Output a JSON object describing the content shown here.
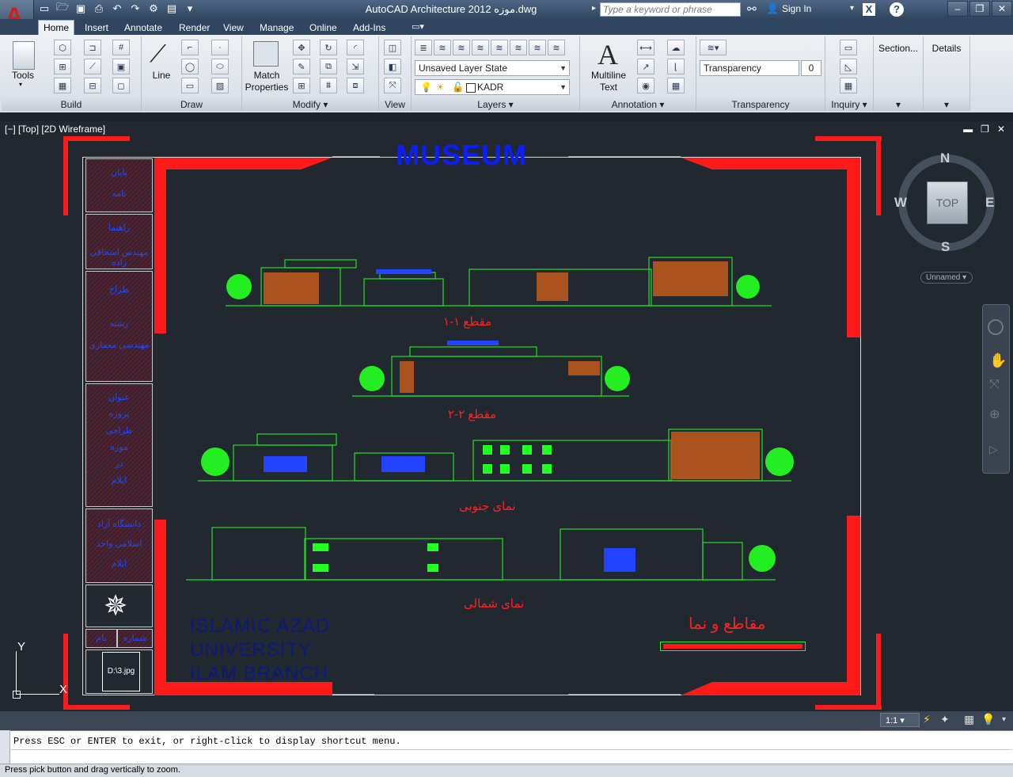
{
  "app": {
    "title": "AutoCAD Architecture 2012   موزه.dwg",
    "search_placeholder": "Type a keyword or phrase",
    "sign_in": "Sign In",
    "app_letter": "A",
    "app_badge": "A"
  },
  "tabs": [
    "Home",
    "Insert",
    "Annotate",
    "Render",
    "View",
    "Manage",
    "Online",
    "Add-Ins"
  ],
  "ribbon": {
    "panels": {
      "build": "Build",
      "draw": "Draw",
      "modify": "Modify",
      "view": "View",
      "layers": "Layers",
      "annotation": "Annotation",
      "transparency": "Transparency",
      "inquiry": "Inquiry"
    },
    "tools_label": "Tools",
    "line_label": "Line",
    "match_properties_label": "Match Properties",
    "match_label_1": "Match",
    "match_label_2": "Properties",
    "multiline_label_1": "Multiline",
    "multiline_label_2": "Text",
    "layer_state": "Unsaved Layer State",
    "current_layer": "KADR",
    "transparency_label": "Transparency",
    "transparency_value": "0",
    "section_label": "Section...",
    "details_label": "Details"
  },
  "viewport": {
    "label": "[−] [Top] [2D Wireframe]",
    "wcs": "Unnamed"
  },
  "drawing": {
    "title": "MUSEUM",
    "sections": [
      "مقطع ۱-۱",
      "مقطع ۲-۲",
      "نمای جنوبی",
      "نمای شمالی"
    ],
    "sheet_title": "مقاطع و نما",
    "university_lines": [
      "ISLAMIC AZAD",
      "UNIVERSITY",
      "ILAM BRANCH"
    ],
    "side_cells": [
      [
        "پایان",
        "نامه"
      ],
      [
        "راهنما",
        "مهندس اسحاقی زاده"
      ],
      [
        "طراح",
        "",
        "رشته",
        "مهندسی معماری"
      ],
      [
        "عنوان",
        "پروژه",
        "طراحی",
        "موزه",
        "در",
        "ایلام"
      ],
      [
        "دانشگاه   آزاد",
        "اسلامی  واحد",
        "ایلام"
      ]
    ],
    "small_cells": [
      "نام",
      "شماره"
    ],
    "logo_caption": "D:\\3.jpg"
  },
  "compass": {
    "n": "N",
    "s": "S",
    "e": "E",
    "w": "W",
    "top": "TOP"
  },
  "axis": {
    "x": "X",
    "y": "Y"
  },
  "scale": "1:1",
  "command_line": "Press ESC or ENTER to exit, or right-click to display shortcut menu.",
  "status_text": "Press pick button and drag vertically to zoom."
}
